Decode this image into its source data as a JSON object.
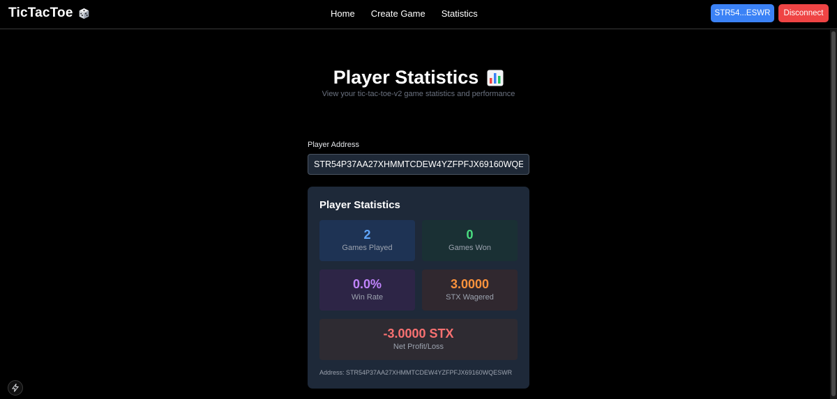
{
  "header": {
    "brand": "TicTacToe",
    "brand_icon": "dice-icon",
    "nav": [
      {
        "label": "Home"
      },
      {
        "label": "Create Game"
      },
      {
        "label": "Statistics"
      }
    ],
    "wallet_label": "STR54...ESWR",
    "disconnect_label": "Disconnect"
  },
  "page": {
    "title": "Player Statistics",
    "title_icon": "bar-chart-icon",
    "subtitle": "View your tic-tac-toe-v2 game statistics and performance"
  },
  "address_field": {
    "label": "Player Address",
    "value": "STR54P37AA27XHMMTCDEW4YZFPFJX69160WQESWR",
    "placeholder": ""
  },
  "stats": {
    "heading": "Player Statistics",
    "games_played": {
      "value": "2",
      "label": "Games Played"
    },
    "games_won": {
      "value": "0",
      "label": "Games Won"
    },
    "win_rate": {
      "value": "0.0%",
      "label": "Win Rate"
    },
    "stx_wagered": {
      "value": "3.0000",
      "label": "STX Wagered"
    },
    "net_profit": {
      "value": "-3.0000 STX",
      "label": "Net Profit/Loss"
    },
    "address_footer": "Address: STR54P37AA27XHMMTCDEW4YZFPFJX69160WQESWR"
  },
  "colors": {
    "wallet_button": "#3b82f6",
    "disconnect_button": "#ef4444",
    "card_background": "#1e2939",
    "played": "#60a5fa",
    "won": "#4ade80",
    "win_rate": "#c084fc",
    "wagered": "#fb923c",
    "net": "#f87171"
  },
  "floating": {
    "icon": "lightning-bolt-icon"
  }
}
